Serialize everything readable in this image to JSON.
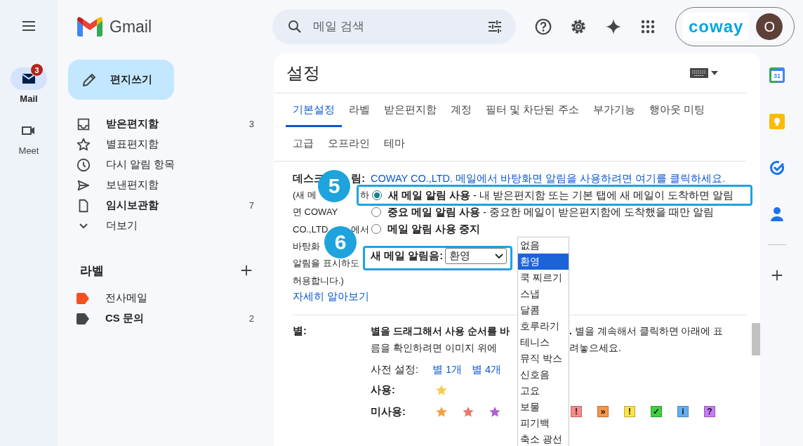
{
  "rail": {
    "items": [
      {
        "label": "Mail",
        "selected": true,
        "badge": "3"
      },
      {
        "label": "Meet",
        "selected": false
      }
    ]
  },
  "header": {
    "brand": "Gmail",
    "search": {
      "placeholder": "메일 검색"
    },
    "account": {
      "org": "coway",
      "avatar": "O"
    }
  },
  "sidebar": {
    "compose": "편지쓰기",
    "items": [
      {
        "label": "받은편지함",
        "count": "3",
        "unread": true
      },
      {
        "label": "별표편지함",
        "unread": false
      },
      {
        "label": "다시 알림 항목",
        "unread": false
      },
      {
        "label": "보낸편지함",
        "unread": false
      },
      {
        "label": "임시보관함",
        "count": "7",
        "unread": true
      },
      {
        "label": "더보기",
        "unread": false
      }
    ],
    "labels_title": "라벨",
    "labels": [
      {
        "label": "전사메일",
        "color": "#f4511e",
        "unread": false
      },
      {
        "label": "CS 문의",
        "color": "#444746",
        "count": "2",
        "unread": true
      }
    ]
  },
  "settings": {
    "title": "설정",
    "tab_rows": [
      [
        {
          "label": "기본설정",
          "selected": true
        },
        {
          "label": "라벨",
          "selected": false
        },
        {
          "label": "받은편지함",
          "selected": false
        },
        {
          "label": "계정",
          "selected": false
        },
        {
          "label": "필터 및 차단된 주소",
          "selected": false
        },
        {
          "label": "부가기능",
          "selected": false
        },
        {
          "label": "행아웃 미팅",
          "selected": false
        }
      ],
      [
        {
          "label": "고급",
          "selected": false
        },
        {
          "label": "오프라인",
          "selected": false
        },
        {
          "label": "테마",
          "selected": false
        }
      ]
    ],
    "desktop": {
      "label_parts": [
        "데스크",
        "림:"
      ],
      "link": "COWAY CO.,LTD. 메일에서 바탕화면 알림을 사용하려면 여기를 클릭하세요.",
      "note_lines": [
        [
          "(새 메",
          "하"
        ],
        [
          "면 COWAY"
        ],
        [
          "CO.,LTD.",
          "에서"
        ],
        [
          "바탕화"
        ],
        [
          "알림을 표시하도"
        ],
        [
          "허용합니다.)"
        ]
      ],
      "learn_more": "자세히 알아보기",
      "options": [
        {
          "text": "**새 메일 알림 사용** - 내 받은편지함 또는 기본 탭에 새 메일이 도착하면 알림",
          "selected": true
        },
        {
          "text": "**중요 메일 알림 사용** - 중요한 메일이 받은편지함에 도착했을 때만 알림",
          "selected": false
        },
        {
          "text": "**메일 알림 사용 중지**",
          "selected": false
        }
      ],
      "sound": {
        "label": "새 메일 알림음:",
        "value": "환영",
        "options": [
          {
            "label": "없음",
            "selected": false
          },
          {
            "label": "환영",
            "selected": true
          },
          {
            "label": "쿡 찌르기",
            "selected": false
          },
          {
            "label": "스냅",
            "selected": false
          },
          {
            "label": "달콤",
            "selected": false
          },
          {
            "label": "호루라기",
            "selected": false
          },
          {
            "label": "테니스",
            "selected": false
          },
          {
            "label": "뮤직 박스",
            "selected": false
          },
          {
            "label": "신호음",
            "selected": false
          },
          {
            "label": "고요",
            "selected": false
          },
          {
            "label": "보물",
            "selected": false
          },
          {
            "label": "피기백",
            "selected": false
          },
          {
            "label": "축소 광선",
            "selected": false
          }
        ]
      }
    },
    "stars": {
      "label": "별:",
      "intro_lines": [
        [
          "**별을 드래그해서 사용 순서를 바**",
          "**.** 별을 계속해서 클릭하면 아래에 표"
        ],
        [
          "름을 확인하려면 이미지 위에",
          "려놓으세요."
        ]
      ],
      "presets_label": "사전 설정:",
      "presets": [
        "별 1개",
        "별 4개"
      ],
      "used_label": "사용:",
      "used": [
        {
          "color": "#f7cb4d"
        }
      ],
      "unused_label": "미사용:",
      "unused": [
        {
          "color": "#f6a040"
        },
        {
          "color": "#e8776e"
        },
        {
          "color": "#b061d4"
        }
      ],
      "markers": [
        {
          "glyph": "!",
          "color": "#f88b8b"
        },
        {
          "glyph": "»",
          "color": "#f79549"
        },
        {
          "glyph": "!",
          "color": "#fbe44b"
        },
        {
          "glyph": "✓",
          "color": "#3fcf3f"
        },
        {
          "glyph": "i",
          "color": "#64aff2"
        },
        {
          "glyph": "?",
          "color": "#c87af7"
        }
      ]
    }
  },
  "callouts": [
    {
      "number": "5"
    },
    {
      "number": "6"
    }
  ],
  "right_rail": {
    "calendar_day": "31"
  }
}
